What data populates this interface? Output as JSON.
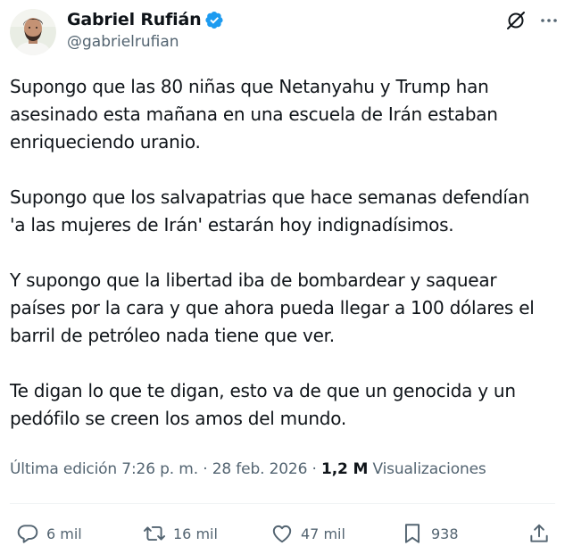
{
  "author": {
    "display_name": "Gabriel Rufián",
    "handle": "@gabrielrufian"
  },
  "icons": {
    "verified": "verified-badge-icon",
    "grok": "grok-icon",
    "more": "more-options-icon",
    "reply": "reply-icon",
    "retweet": "retweet-icon",
    "like": "like-icon",
    "bookmark": "bookmark-icon",
    "share": "share-icon"
  },
  "colors": {
    "verified": "#1d9bf0",
    "text": "#0f1419",
    "secondary": "#536471"
  },
  "tweet": {
    "paragraphs": [
      "Supongo que las 80 niñas que Netanyahu y Trump han\nasesinado esta mañana en una escuela de Irán estaban\nenriqueciendo uranio.",
      "Supongo que los salvapatrias que hace semanas defendían\n'a las mujeres de Irán' estarán hoy indignadísimos.",
      "Y supongo que la libertad iba de bombardear y saquear\npaíses por la cara y que ahora pueda llegar a 100 dólares el\nbarril de petróleo nada tiene que ver.",
      "Te digan lo que te digan, esto va de que un genocida y un\npedófilo se creen los amos del mundo."
    ]
  },
  "meta": {
    "edited_label": "Última edición 7:26 p. m.",
    "separator": " · ",
    "date": "28 feb. 2026",
    "views_count": "1,2 M",
    "views_label": "Visualizaciones"
  },
  "actions": {
    "replies": "6 mil",
    "retweets": "16 mil",
    "likes": "47 mil",
    "bookmarks": "938"
  }
}
